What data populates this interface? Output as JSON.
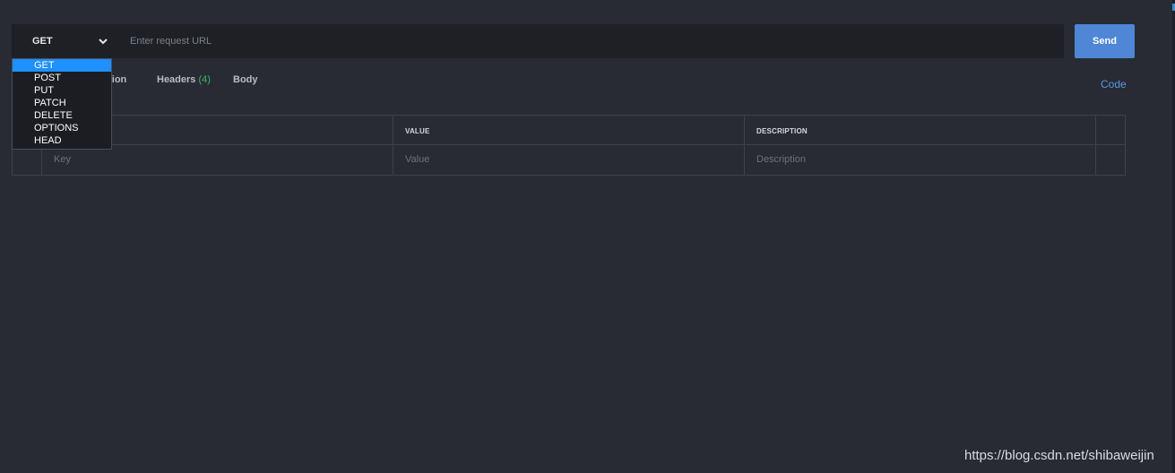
{
  "request": {
    "method": "GET",
    "url_placeholder": "Enter request URL",
    "url_value": "",
    "send_label": "Send"
  },
  "tabs": {
    "authorization_partial": "ation",
    "headers_label": "Headers",
    "headers_count": "(4)",
    "body_label": "Body"
  },
  "code_label": "Code",
  "table": {
    "columns": [
      "VALUE",
      "DESCRIPTION"
    ],
    "placeholders": {
      "key": "Key",
      "value": "Value",
      "description": "Description"
    }
  },
  "method_options": [
    "GET",
    "POST",
    "PUT",
    "PATCH",
    "DELETE",
    "OPTIONS",
    "HEAD"
  ],
  "selected_method_index": 0,
  "watermark": "https://blog.csdn.net/shibaweijin",
  "colors": {
    "background": "#282b34",
    "send_button": "#4f86d6",
    "selected_option": "#1e90ff",
    "headers_count": "#3cba5d",
    "code_link": "#5b97e3"
  }
}
